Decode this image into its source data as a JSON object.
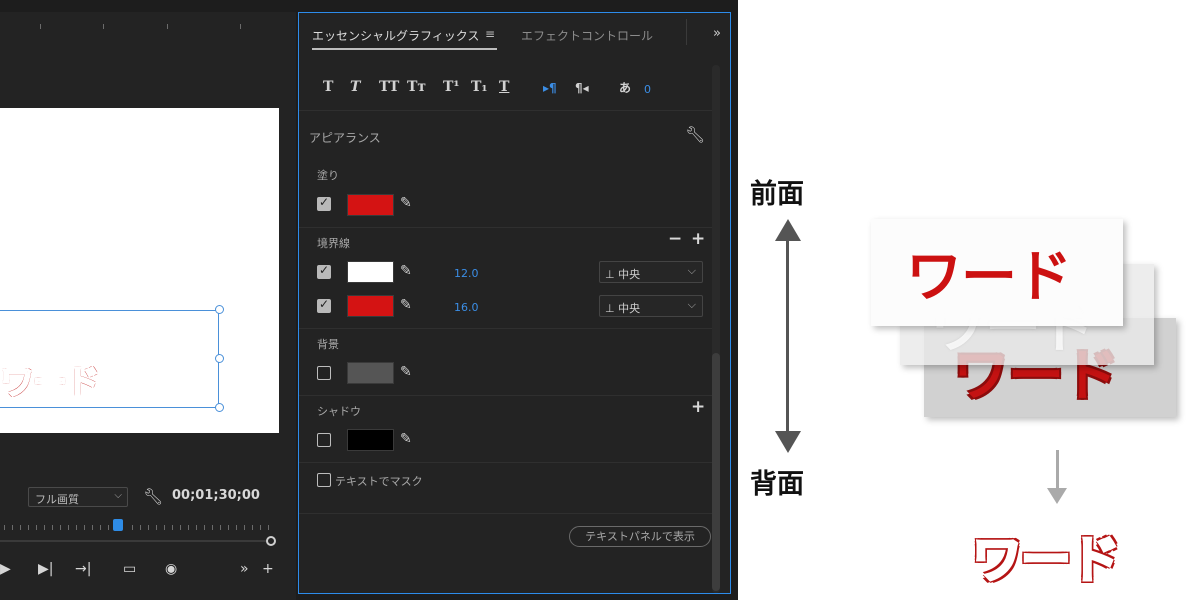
{
  "monitor": {
    "overlay_text": "ワード",
    "quality": "フル画質",
    "timecode": "00;01;30;00"
  },
  "panel": {
    "tab_essential_graphics": "エッセンシャルグラフィックス",
    "tab_menu_icon": "≡",
    "tab_effect_controls": "エフェクトコントロール",
    "more_icon": "»",
    "format_buttons": [
      "T",
      "T",
      "TT",
      "Tт",
      "T¹",
      "T₁",
      "T"
    ],
    "tsume_value": "0",
    "appearance_title": "アピアランス",
    "fill": {
      "label": "塗り",
      "checked": true,
      "color": "#d41313"
    },
    "stroke": {
      "label": "境界線",
      "rows": [
        {
          "checked": true,
          "color": "#ffffff",
          "width": "12.0",
          "position": "中央"
        },
        {
          "checked": true,
          "color": "#d41313",
          "width": "16.0",
          "position": "中央"
        }
      ]
    },
    "background": {
      "label": "背景",
      "checked": false,
      "color": "#555555"
    },
    "shadow": {
      "label": "シャドウ",
      "checked": false,
      "color": "#000000"
    },
    "mask_label": "テキストでマスク",
    "textpanel_button": "テキストパネルで表示"
  },
  "diagram": {
    "front_label": "前面",
    "back_label": "背面",
    "layer_front_text": "ワード",
    "layer_mid_text": "ワード",
    "layer_back_text": "ワード",
    "result_text": "ワード"
  }
}
